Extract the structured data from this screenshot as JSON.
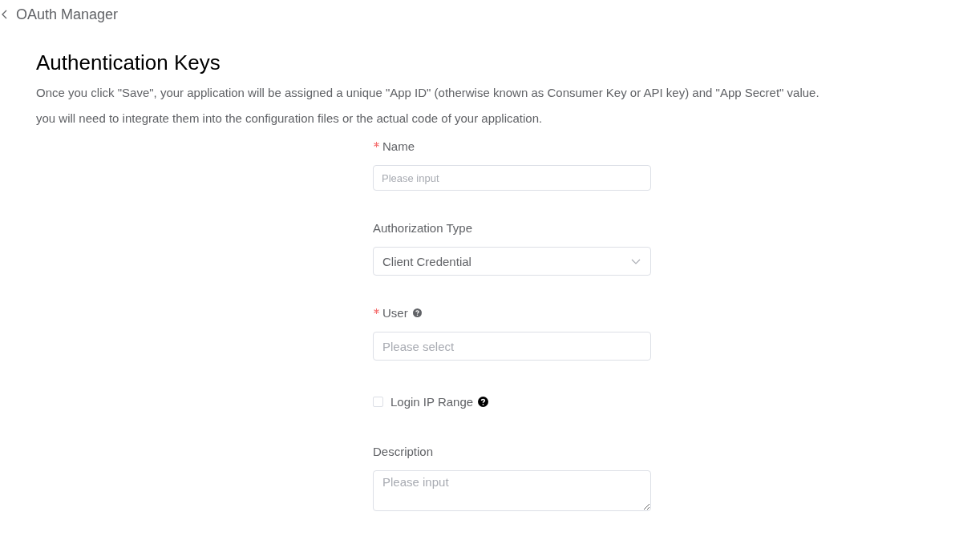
{
  "header": {
    "back_label": "OAuth Manager"
  },
  "title": "Authentication Keys",
  "intro": [
    "Once you click \"Save\", your application will be assigned a unique \"App ID\" (otherwise known as Consumer Key or API key) and \"App Secret\" value.",
    "you will need to integrate them into the configuration files or the actual code of your application."
  ],
  "form": {
    "fields": [
      {
        "kind": "text",
        "label": "Name",
        "required": true,
        "help": false,
        "placeholder": "Please input"
      },
      {
        "kind": "select",
        "label": "Authorization Type",
        "required": false,
        "help": false,
        "value": "Client Credential"
      },
      {
        "kind": "picker",
        "label": "User",
        "required": true,
        "help": true,
        "placeholder": "Please select"
      },
      {
        "kind": "checkbox",
        "label": "Login IP Range",
        "checked": false,
        "help": true
      },
      {
        "kind": "textarea",
        "label": "Description",
        "required": false,
        "help": false,
        "placeholder": "Please input"
      }
    ]
  }
}
